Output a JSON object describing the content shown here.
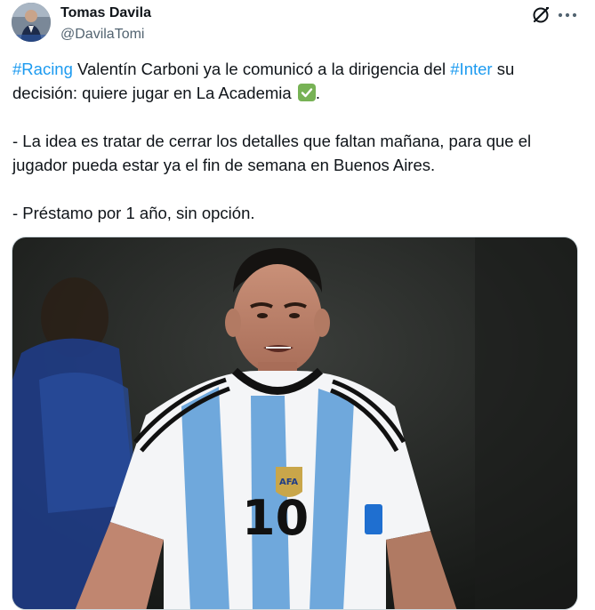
{
  "author": {
    "display_name": "Tomas Davila",
    "handle": "@DavilaTomi",
    "avatar_icon": "avatar-photo"
  },
  "actions": {
    "grok_icon": "grok-icon",
    "more_icon": "more-icon"
  },
  "tweet": {
    "line1_hashtag1": "#Racing",
    "line1_text1": " Valentín Carboni ya le comunicó a la dirigencia del ",
    "line1_hashtag2": "#Inter",
    "line1_text2": " su decisión: quiere jugar en La Academia ",
    "line1_end": ".",
    "paragraph2": "- La idea es tratar de cerrar los detalles que faltan mañana, para que el jugador pueda estar ya el fin de semana en Buenos Aires.",
    "paragraph3": "- Préstamo por 1 año, sin opción.",
    "check_emoji": "check-mark-button-emoji"
  },
  "media": {
    "description_icon": "photo",
    "shirt_number": "10",
    "badge_text": "AFA"
  },
  "colors": {
    "hashtag": "#1d9bf0",
    "text": "#0f1419",
    "secondary": "#536471",
    "emoji_green": "#77b255"
  }
}
